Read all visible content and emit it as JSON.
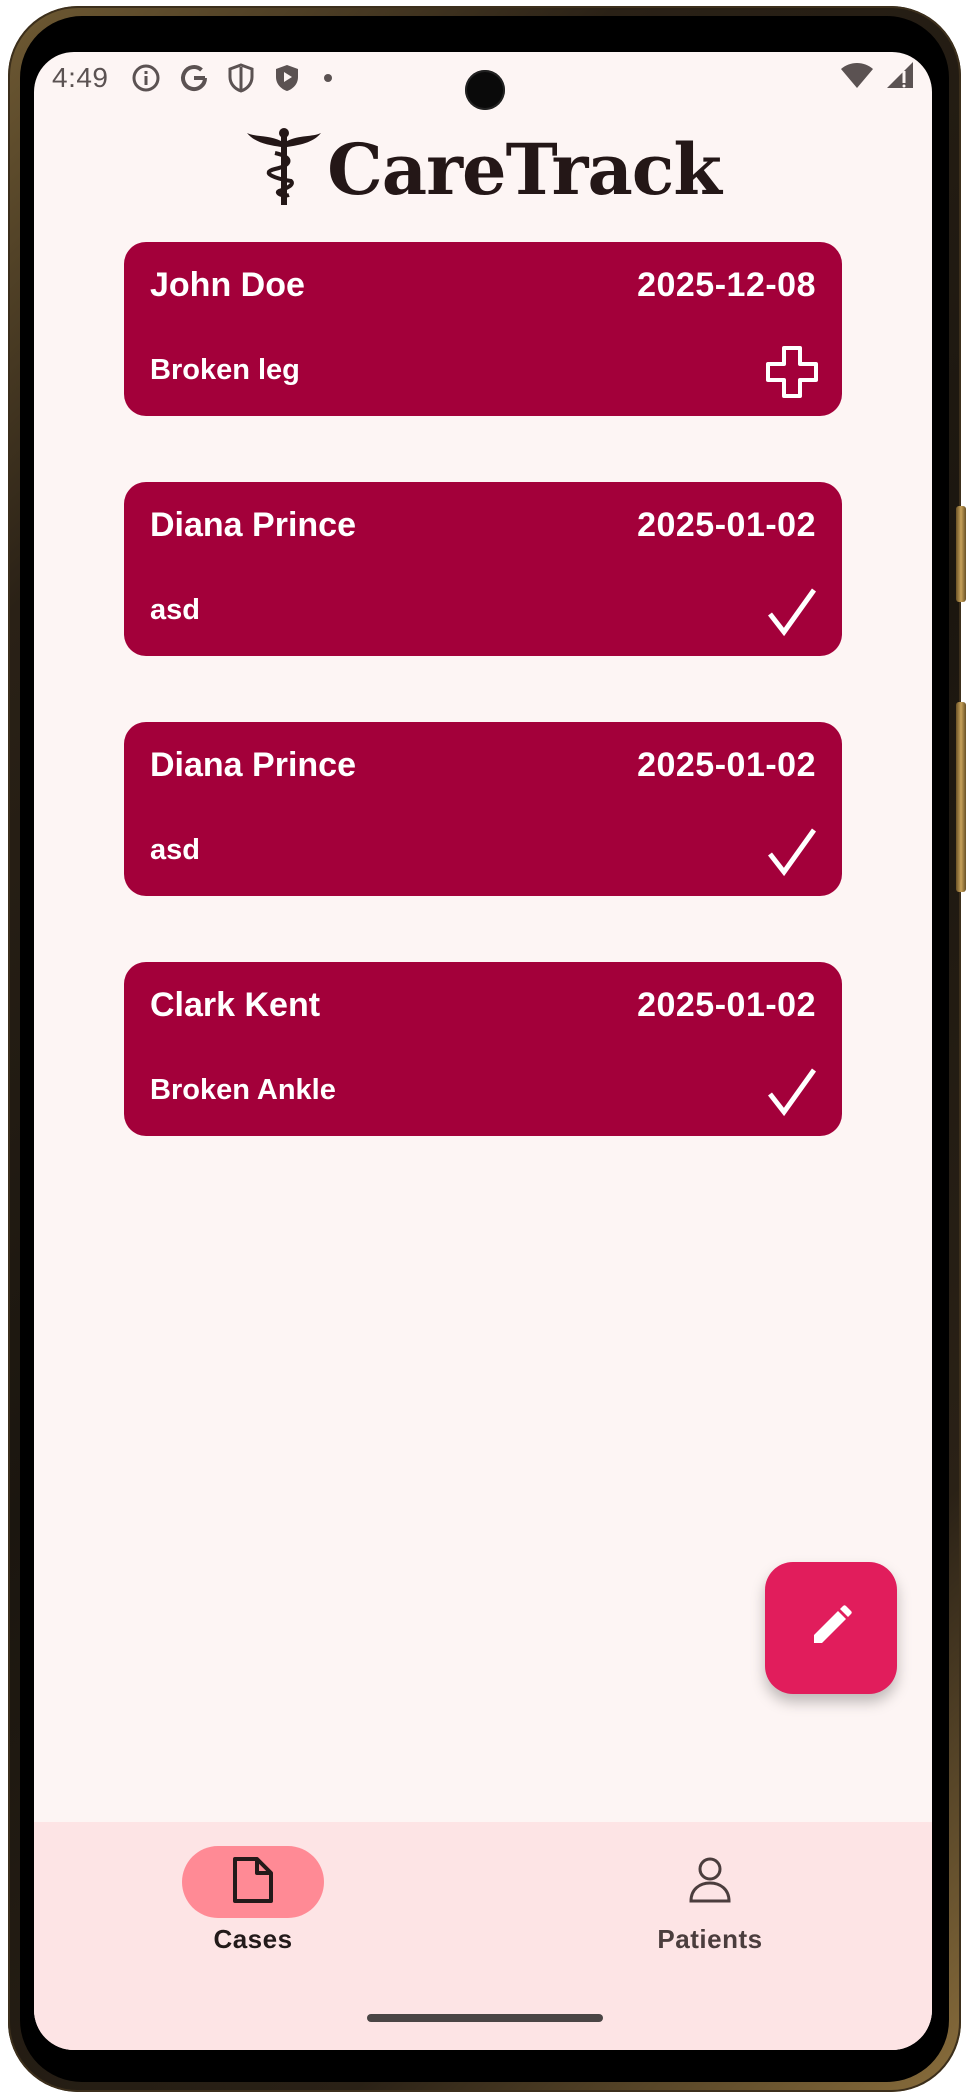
{
  "status_bar": {
    "time": "4:49",
    "icons": [
      "info-icon",
      "google-icon",
      "shield-icon",
      "play-protect-icon",
      "dot-icon"
    ],
    "right_icons": [
      "wifi-icon",
      "signal-icon"
    ]
  },
  "app": {
    "title": "CareTrack",
    "logo_icon": "caduceus-icon",
    "brand_color": "#a3003a"
  },
  "cases": [
    {
      "name": "John Doe",
      "date": "2025-12-08",
      "description": "Broken leg",
      "status_icon": "plus-icon"
    },
    {
      "name": "Diana Prince",
      "date": "2025-01-02",
      "description": "asd",
      "status_icon": "check-icon"
    },
    {
      "name": "Diana Prince",
      "date": "2025-01-02",
      "description": "asd",
      "status_icon": "check-icon"
    },
    {
      "name": "Clark Kent",
      "date": "2025-01-02",
      "description": "Broken Ankle",
      "status_icon": "check-icon"
    }
  ],
  "fab": {
    "icon": "pencil-icon",
    "color": "#e11d5c"
  },
  "bottom_nav": {
    "items": [
      {
        "label": "Cases",
        "icon": "document-icon",
        "active": true
      },
      {
        "label": "Patients",
        "icon": "person-icon",
        "active": false
      }
    ]
  }
}
